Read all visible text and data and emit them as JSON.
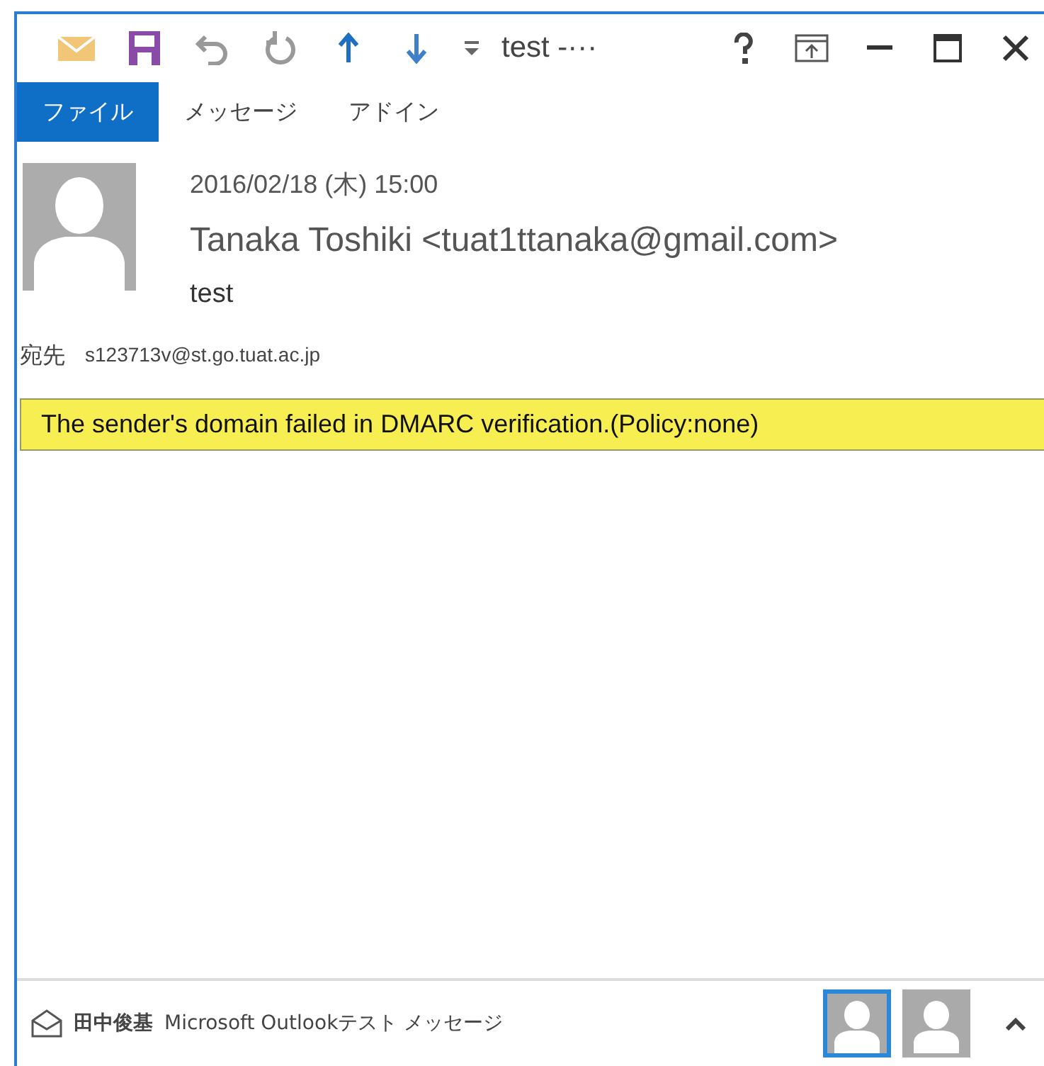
{
  "window": {
    "title": "test -···"
  },
  "ribbon_tabs": [
    {
      "label": "ファイル",
      "selected": true
    },
    {
      "label": "メッセージ",
      "selected": false
    },
    {
      "label": "アドイン",
      "selected": false
    }
  ],
  "message": {
    "date": "2016/02/18 (木) 15:00",
    "sender": "Tanaka Toshiki <tuat1ttanaka@gmail.com>",
    "subject": "test",
    "to_label": "宛先",
    "to": "s123713v@st.go.tuat.ac.jp"
  },
  "info_bar": "The sender's domain failed in DMARC verification.(Policy:none)",
  "people_pane": {
    "name": "田中俊基",
    "snippet": "Microsoft Outlookテスト メッセージ",
    "contacts": [
      {
        "selected": true
      },
      {
        "selected": false
      }
    ]
  }
}
